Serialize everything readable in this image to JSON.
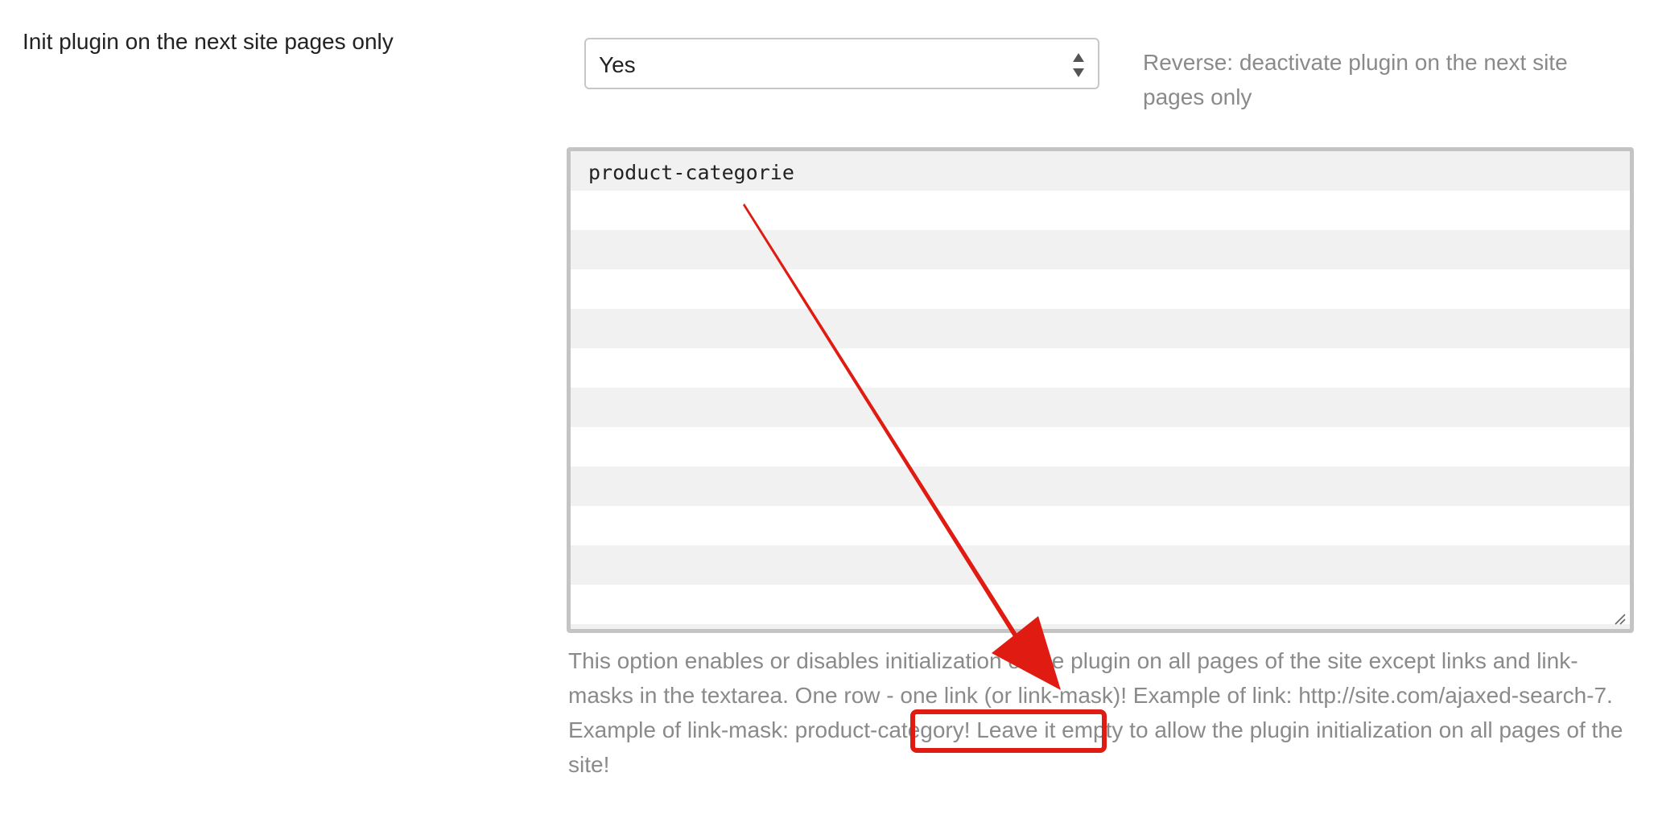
{
  "setting": {
    "label": "Init plugin on the next site pages only",
    "select": {
      "value": "Yes",
      "icon": "updown-arrows-icon"
    },
    "select_hint": "Reverse: deactivate plugin on the next site pages only",
    "textarea": {
      "value": "product-categorie"
    },
    "description": "This option enables or disables initialization of the plugin on all pages of the site except links and link-masks in the textarea. One row - one link (or link-mask)! Example of link: http://site.com/ajaxed-search-7. Example of link-mask: product-category! Leave it empty to allow the plugin initialization on all pages of the site!"
  },
  "annotation": {
    "color": "#e01b12",
    "icon": "red-arrow-icon"
  }
}
